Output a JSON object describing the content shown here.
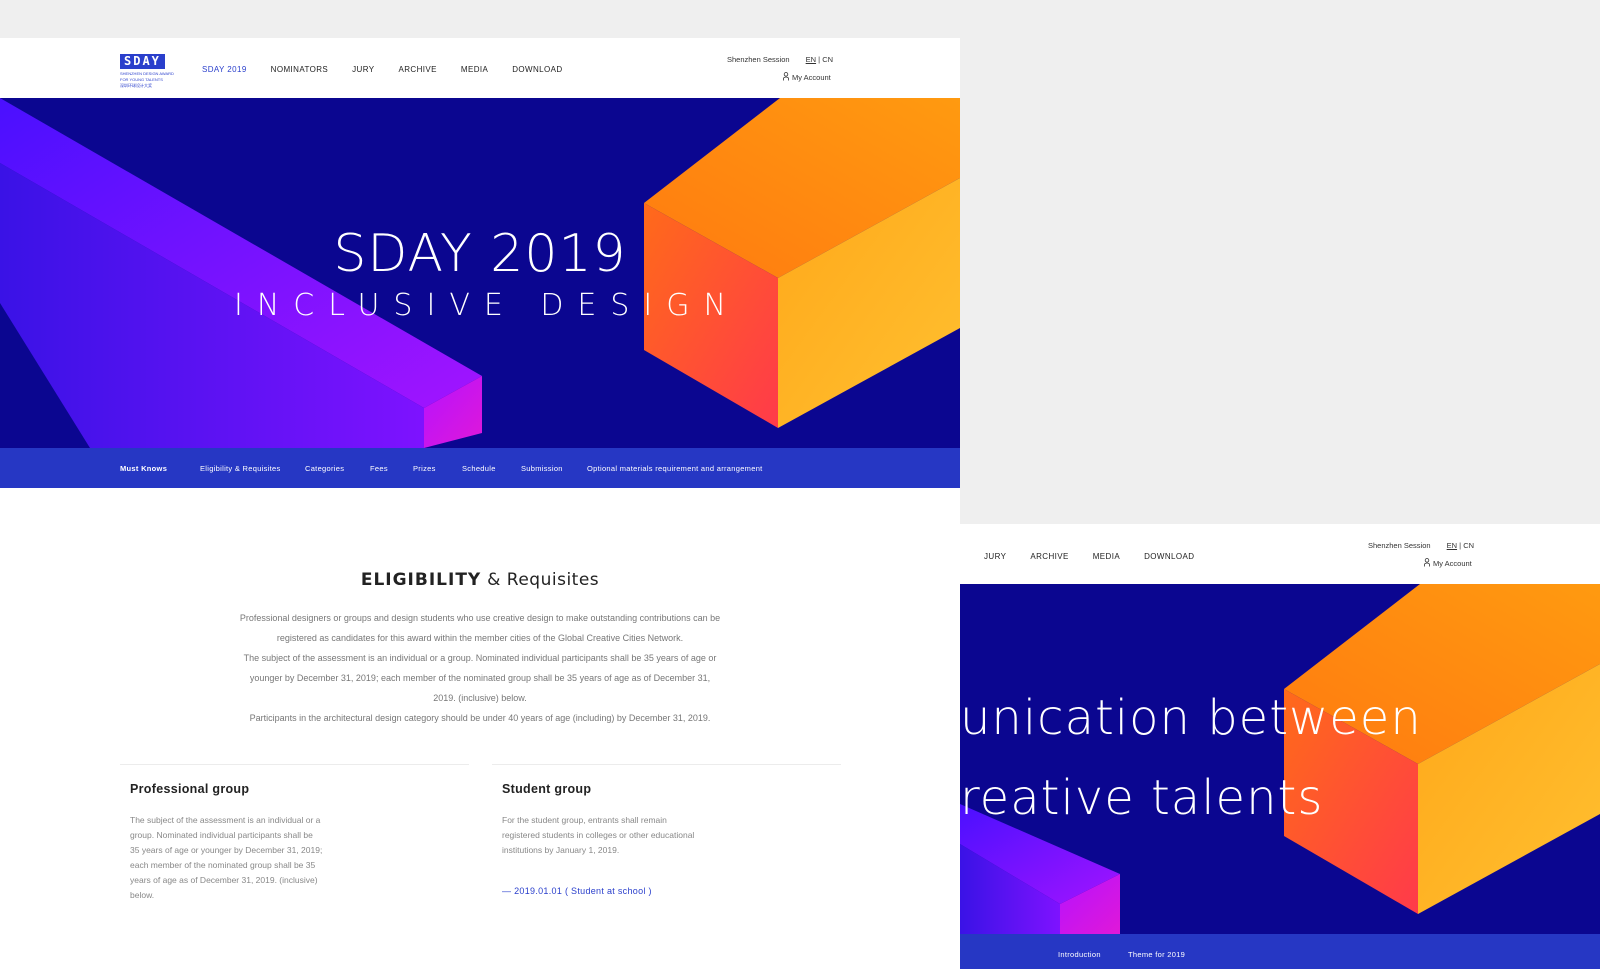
{
  "logo": {
    "text": "SDAY",
    "sub1": "SHENZHEN DESIGN AWARD",
    "sub2": "FOR YOUNG TALENTS",
    "sub3": "深圳环球设计大奖"
  },
  "nav": {
    "items": [
      {
        "label": "SDAY 2019",
        "active": true
      },
      {
        "label": "NOMINATORS"
      },
      {
        "label": "JURY"
      },
      {
        "label": "ARCHIVE"
      },
      {
        "label": "MEDIA"
      },
      {
        "label": "DOWNLOAD"
      }
    ]
  },
  "header": {
    "session": "Shenzhen Session",
    "lang_en": "EN",
    "lang_sep": "|",
    "lang_cn": "CN",
    "account": "My Account"
  },
  "hero": {
    "title": "SDAY 2019",
    "subtitle": "INCLUSIVE DESIGN"
  },
  "subnav": {
    "items": [
      "Must Knows",
      "Eligibility & Requisites",
      "Categories",
      "Fees",
      "Prizes",
      "Schedule",
      "Submission",
      "Optional materials requirement and arrangement"
    ]
  },
  "eligibility": {
    "title_bold": "ELIGIBILITY",
    "title_rest": "& Requisites",
    "lines": [
      "Professional designers or groups and design students who use creative design to make outstanding contributions can be",
      "registered as candidates for this award within the member cities of the Global Creative Cities Network.",
      "The subject of the assessment is an individual or a group. Nominated individual participants shall be 35 years of age or",
      "younger by December 31, 2019; each member of the nominated group shall be 35 years of age as of December 31,",
      "2019. (inclusive) below.",
      "Participants in the architectural design category should be under 40 years of age (including) by December 31, 2019."
    ]
  },
  "professional": {
    "title": "Professional group",
    "lines": [
      "The subject of the assessment is an individual or a",
      "group. Nominated individual participants shall be",
      "35 years of age or younger by December 31, 2019;",
      "each member of the nominated group shall be 35",
      "years of age as of December 31, 2019. (inclusive)",
      "below."
    ]
  },
  "student": {
    "title": "Student group",
    "lines": [
      "For the student group, entrants shall remain",
      "registered students in colleges or other educational",
      "institutions by January 1, 2019."
    ],
    "link": "— 2019.01.01  ( Student at school )"
  },
  "second": {
    "nav": [
      "JURY",
      "ARCHIVE",
      "MEDIA",
      "DOWNLOAD"
    ],
    "hero_line1": "unication between",
    "hero_line2": "reative talents",
    "subnav": [
      "Introduction",
      "Theme for 2019"
    ]
  },
  "colors": {
    "hero_bg": "#0b0690",
    "subnav_bg": "#2637c4",
    "accent": "#2a3fcc"
  }
}
